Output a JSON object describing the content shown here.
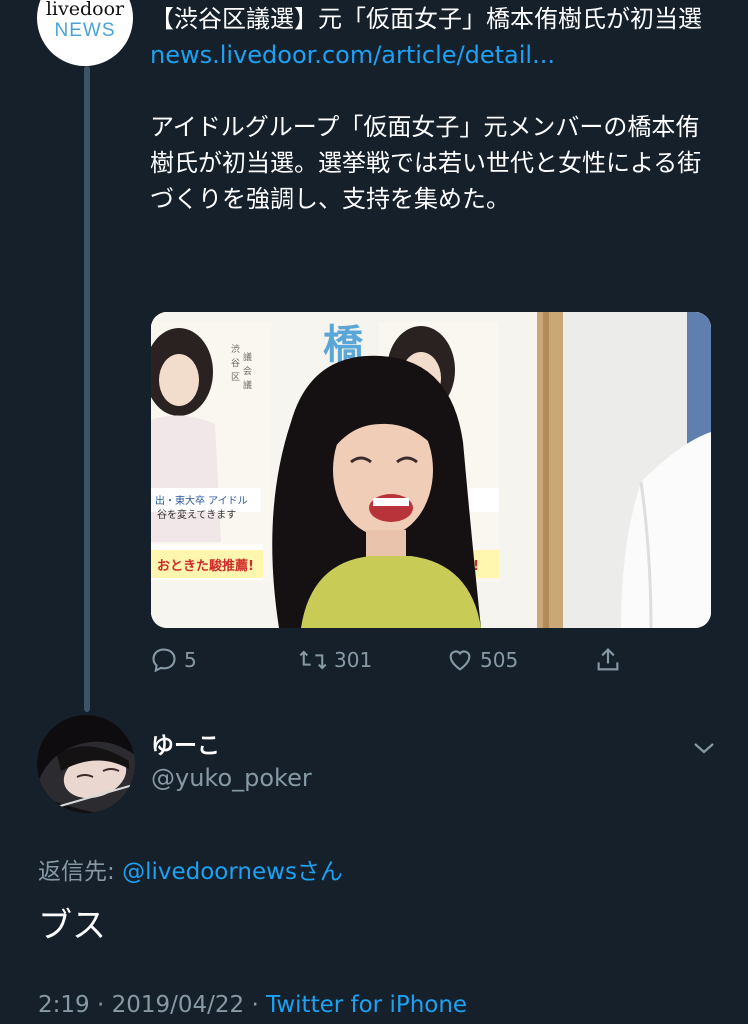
{
  "parent_tweet": {
    "avatar": {
      "logo_top": "livedoor",
      "logo_bottom": "NEWS"
    },
    "headline": "【渋谷区議選】元「仮面女子」橋本侑樹氏が初当選",
    "link": "news.livedoor.com/article/detail...",
    "summary": "アイドルグループ「仮面女子」元メンバーの橋本侑樹氏が初当選。選挙戦では若い世代と女性による街づくりを強調し、支持を集めた。",
    "media": {
      "poster_texts": [
        "橋",
        "おときた駿推薦!",
        "おときた駿推薦!"
      ]
    },
    "actions": {
      "reply_count": "5",
      "retweet_count": "301",
      "like_count": "505"
    }
  },
  "reply_tweet": {
    "display_name": "ゆーこ",
    "handle": "@yuko_poker",
    "replying_label": "返信先: ",
    "replying_mention": "@livedoornews",
    "replying_suffix": "さん",
    "text": "ブス",
    "time": "2:19",
    "date": "2019/04/22",
    "separator": " · ",
    "source": "Twitter for iPhone"
  },
  "colors": {
    "background": "#15202b",
    "link": "#1da1f2",
    "secondary_text": "#8899a6"
  }
}
